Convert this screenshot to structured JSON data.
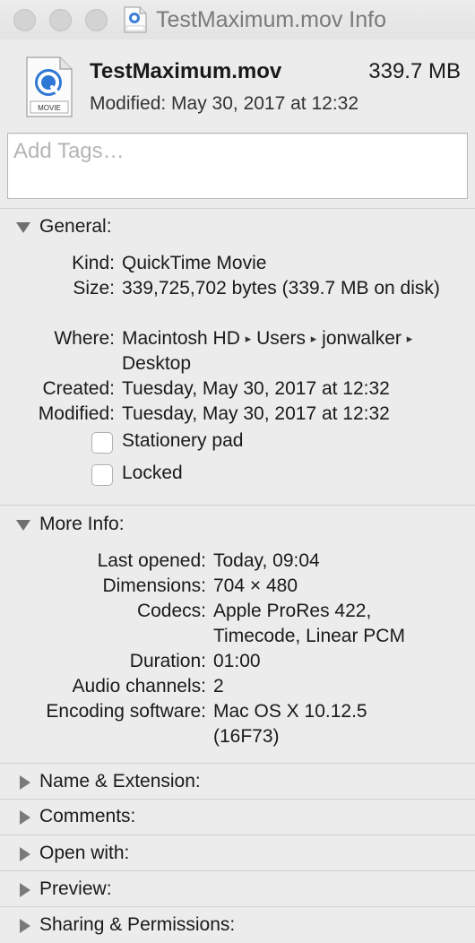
{
  "window": {
    "title": "TestMaximum.mov Info"
  },
  "header": {
    "file_name": "TestMaximum.mov",
    "file_size": "339.7 MB",
    "modified": "Modified: May 30, 2017 at 12:32",
    "icon_label": "MOVIE"
  },
  "tags": {
    "placeholder": "Add Tags…"
  },
  "general": {
    "label": "General:",
    "kind_label": "Kind:",
    "kind_value": "QuickTime Movie",
    "size_label": "Size:",
    "size_value": "339,725,702 bytes (339.7 MB on disk)",
    "where_label": "Where:",
    "where_path": [
      "Macintosh HD",
      "Users",
      "jonwalker",
      "Desktop"
    ],
    "created_label": "Created:",
    "created_value": "Tuesday, May 30, 2017 at 12:32",
    "modified_label": "Modified:",
    "modified_value": "Tuesday, May 30, 2017 at 12:32",
    "stationery_label": "Stationery pad",
    "locked_label": "Locked"
  },
  "more_info": {
    "label": "More Info:",
    "last_opened_label": "Last opened:",
    "last_opened_value": "Today, 09:04",
    "dimensions_label": "Dimensions:",
    "dimensions_value": "704 × 480",
    "codecs_label": "Codecs:",
    "codecs_value": "Apple ProRes 422, Timecode, Linear PCM",
    "duration_label": "Duration:",
    "duration_value": "01:00",
    "audio_label": "Audio channels:",
    "audio_value": "2",
    "encoding_label": "Encoding software:",
    "encoding_value": "Mac OS X 10.12.5 (16F73)"
  },
  "sections": {
    "name_extension": "Name & Extension:",
    "comments": "Comments:",
    "open_with": "Open with:",
    "preview": "Preview:",
    "sharing": "Sharing & Permissions:"
  },
  "icons": {
    "window_buttons": [
      "close-icon",
      "minimize-icon",
      "zoom-icon"
    ],
    "file": "quicktime-movie-icon",
    "expanded": "disclosure-triangle-down-icon",
    "collapsed": "disclosure-triangle-right-icon"
  }
}
